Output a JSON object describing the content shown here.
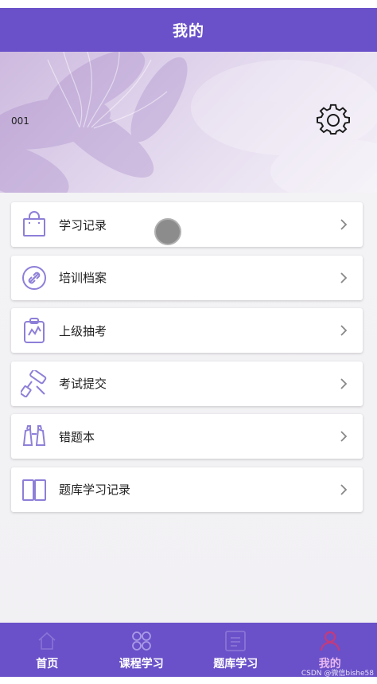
{
  "header": {
    "title": "我的"
  },
  "profile": {
    "user_id": "001",
    "settings_icon": "gear-icon"
  },
  "menu": {
    "items": [
      {
        "label": "学习记录",
        "icon": "shopping-bag-icon"
      },
      {
        "label": "培训档案",
        "icon": "link-icon"
      },
      {
        "label": "上级抽考",
        "icon": "clipboard-chart-icon"
      },
      {
        "label": "考试提交",
        "icon": "roller-brush-icon"
      },
      {
        "label": "错题本",
        "icon": "binoculars-icon"
      },
      {
        "label": "题库学习记录",
        "icon": "book-icon"
      }
    ]
  },
  "tabbar": {
    "items": [
      {
        "label": "首页",
        "icon": "home-icon"
      },
      {
        "label": "课程学习",
        "icon": "grid-icon"
      },
      {
        "label": "题库学习",
        "icon": "document-icon"
      },
      {
        "label": "我的",
        "icon": "user-icon"
      }
    ],
    "active_index": 3
  },
  "watermark": "CSDN @微信bishe58",
  "colors": {
    "primary": "#6a51c9",
    "icon_accent": "#8e7fd8",
    "active_tab": "#e7b8ef"
  }
}
